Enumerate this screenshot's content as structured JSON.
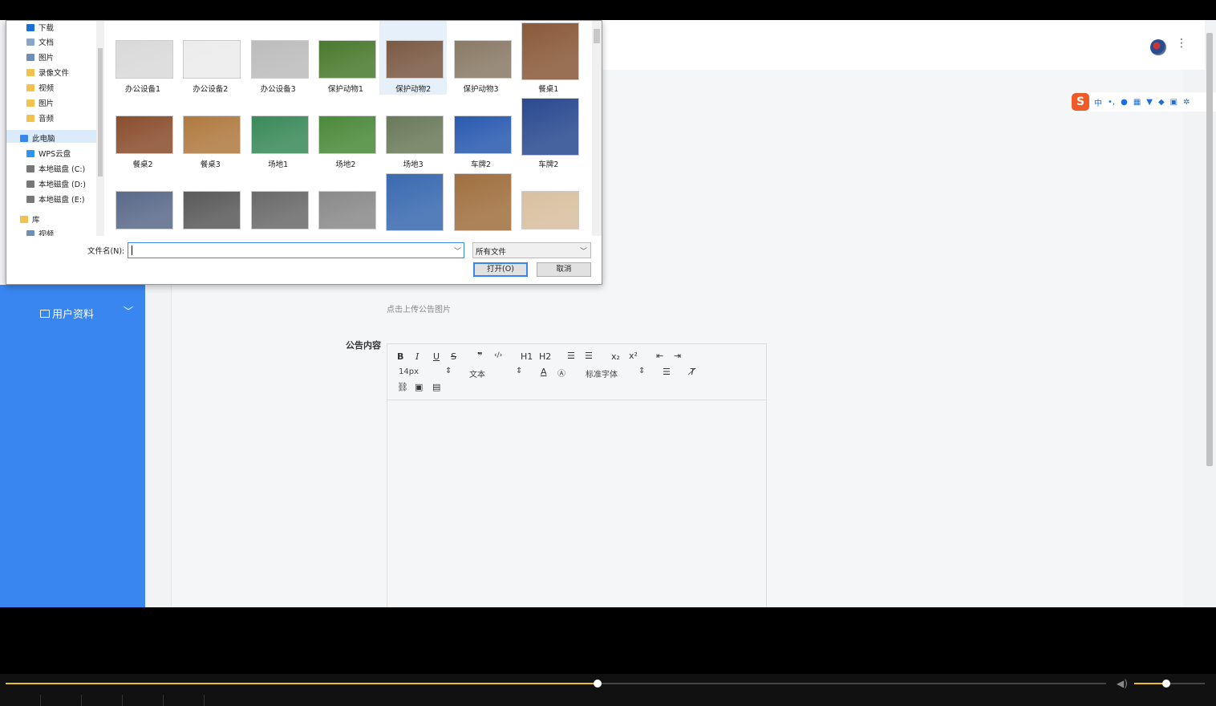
{
  "sidebar": {
    "user_profile": "用户资料"
  },
  "form": {
    "upload_hint": "点击上传公告图片",
    "content_label": "公告内容"
  },
  "editor": {
    "font_size": "14px",
    "format": "文本",
    "font_family": "标准字体",
    "buttons": {
      "bold": "B",
      "italic": "I",
      "underline": "U",
      "strike": "S",
      "h1": "H1",
      "h2": "H2",
      "sub": "x₂",
      "sup": "x²"
    }
  },
  "ime": {
    "logo": "S",
    "lang": "中"
  },
  "dialog": {
    "nav": [
      {
        "label": "下载",
        "color": "#1d6fd8"
      },
      {
        "label": "文档",
        "color": "#8aa6c8"
      },
      {
        "label": "图片",
        "color": "#6b8fb8"
      },
      {
        "label": "录像文件",
        "color": "#f2c14e"
      },
      {
        "label": "视频",
        "color": "#f2c14e"
      },
      {
        "label": "图片",
        "color": "#f2c14e"
      },
      {
        "label": "音频",
        "color": "#f2c14e"
      },
      {
        "label": "此电脑",
        "color": "#3a86f0"
      },
      {
        "label": "WPS云盘",
        "color": "#2b95f0"
      },
      {
        "label": "本地磁盘 (C:)",
        "color": "#777"
      },
      {
        "label": "本地磁盘 (D:)",
        "color": "#777"
      },
      {
        "label": "本地磁盘 (E:)",
        "color": "#777"
      },
      {
        "label": "库",
        "color": "#f2c14e"
      },
      {
        "label": "视频",
        "color": "#6b8fb8"
      }
    ],
    "files": [
      {
        "name": "办公设备1",
        "color": "#d9d9d9"
      },
      {
        "name": "办公设备2",
        "color": "#ececec"
      },
      {
        "name": "办公设备3",
        "color": "#bcbcbc"
      },
      {
        "name": "保护动物1",
        "color": "#4a7a2e"
      },
      {
        "name": "保护动物2",
        "color": "#7a5a44"
      },
      {
        "name": "保护动物3",
        "color": "#8a7a66"
      },
      {
        "name": "餐桌1",
        "color": "#8a5a3a"
      },
      {
        "name": "餐桌2",
        "color": "#8a4e2e"
      },
      {
        "name": "餐桌3",
        "color": "#b07a40"
      },
      {
        "name": "场地1",
        "color": "#3a8a5a"
      },
      {
        "name": "场地2",
        "color": "#4a8a3a"
      },
      {
        "name": "场地3",
        "color": "#6a7a5a"
      },
      {
        "name": "车牌2",
        "color": "#2a5ab0"
      },
      {
        "name": "车牌2",
        "color": "#2a4a90"
      },
      {
        "name": "",
        "color": "#5a6a8a"
      },
      {
        "name": "",
        "color": "#5a5a5a"
      },
      {
        "name": "",
        "color": "#6a6a6a"
      },
      {
        "name": "",
        "color": "#8a8a8a"
      },
      {
        "name": "",
        "color": "#3a6ab0"
      },
      {
        "name": "",
        "color": "#a07040"
      },
      {
        "name": "",
        "color": "#d8c0a0"
      }
    ],
    "filename_label": "文件名(N):",
    "filename_value": "",
    "filetype": "所有文件",
    "open_label": "打开(O)",
    "cancel_label": "取消"
  },
  "player": {
    "progress": 0.538,
    "volume": 0.45
  }
}
